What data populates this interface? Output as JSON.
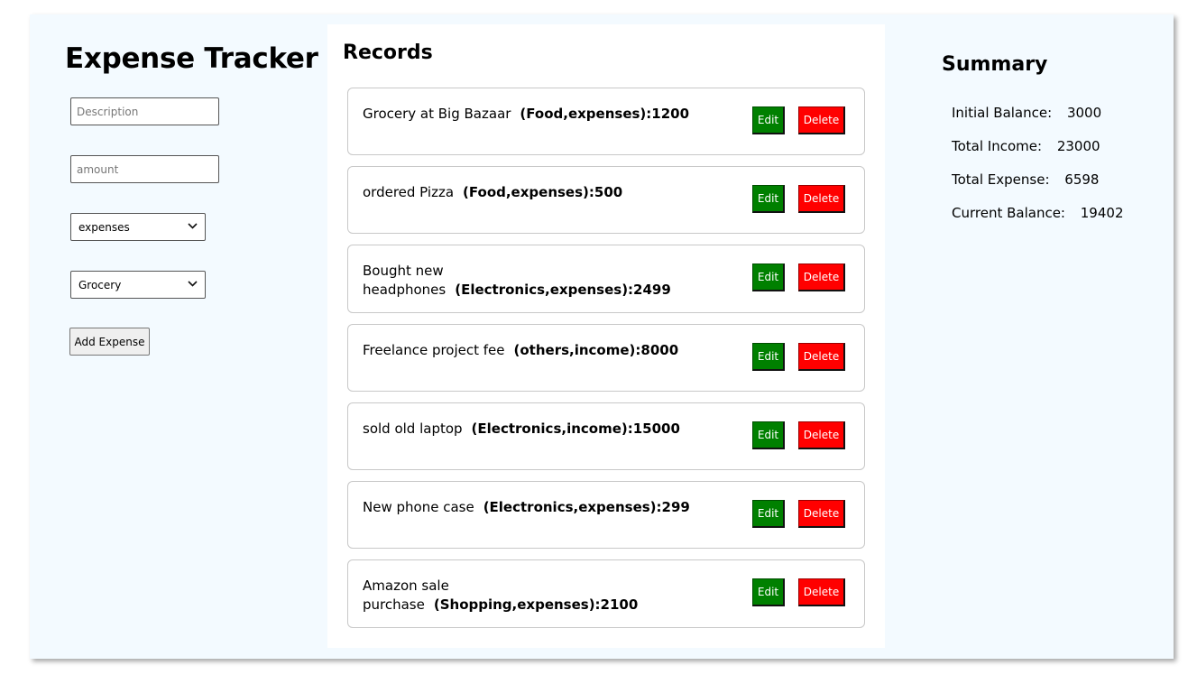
{
  "form": {
    "title": "Expense Tracker",
    "description_placeholder": "Description",
    "amount_placeholder": "amount",
    "type_selected": "expenses",
    "category_selected": "Grocery",
    "add_button": "Add Expense"
  },
  "records": {
    "title": "Records",
    "edit_label": "Edit",
    "delete_label": "Delete",
    "items": [
      {
        "description": "Grocery at Big Bazaar",
        "meta": "(Food,expenses):1200"
      },
      {
        "description": "ordered Pizza",
        "meta": "(Food,expenses):500"
      },
      {
        "description": "Bought new headphones",
        "meta": "(Electronics,expenses):2499"
      },
      {
        "description": "Freelance project fee",
        "meta": "(others,income):8000"
      },
      {
        "description": "sold old laptop",
        "meta": "(Electronics,income):15000"
      },
      {
        "description": "New phone case",
        "meta": "(Electronics,expenses):299"
      },
      {
        "description": "Amazon sale purchase",
        "meta": "(Shopping,expenses):2100"
      }
    ]
  },
  "summary": {
    "title": "Summary",
    "initial_balance_label": "Initial Balance:",
    "initial_balance": "3000",
    "total_income_label": "Total Income:",
    "total_income": "23000",
    "total_expense_label": "Total Expense:",
    "total_expense": "6598",
    "current_balance_label": "Current Balance:",
    "current_balance": "19402"
  }
}
